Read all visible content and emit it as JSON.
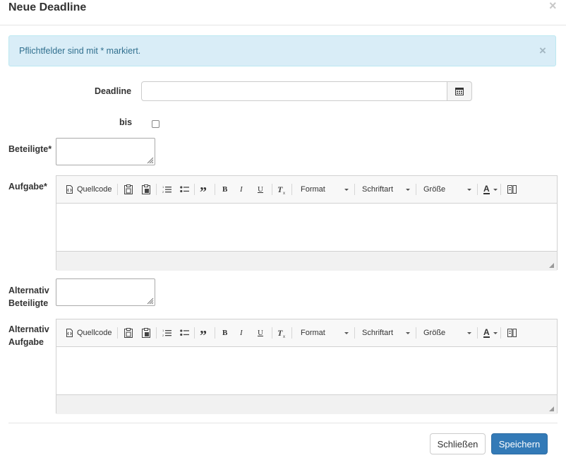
{
  "dialog": {
    "title": "Neue Deadline",
    "close_glyph": "×"
  },
  "alert": {
    "text": "Pflichtfelder sind mit * markiert.",
    "close_glyph": "×"
  },
  "form": {
    "deadline_label": "Deadline",
    "deadline_value": "",
    "bis_label": "bis",
    "bis_checked": false,
    "beteiligte_label": "Beteiligte*",
    "aufgabe_label": "Aufgabe*",
    "alt_beteiligte_label_1": "Alternativ",
    "alt_beteiligte_label_2": "Beteiligte",
    "alt_aufgabe_label_1": "Alternativ",
    "alt_aufgabe_label_2": "Aufgabe"
  },
  "toolbar": {
    "source_label": "Quellcode",
    "bold_label": "B",
    "italic_label": "I",
    "underline_label": "U",
    "quote_glyph": "”",
    "format_label": "Format",
    "font_label": "Schriftart",
    "size_label": "Größe",
    "color_label": "A",
    "icons": [
      "source-icon",
      "paste-icon",
      "paste-word-icon",
      "numbered-list-icon",
      "bullet-list-icon",
      "blockquote-icon",
      "remove-format-icon",
      "text-color-icon",
      "maximize-icon"
    ]
  },
  "buttons": {
    "close_label": "Schließen",
    "save_label": "Speichern"
  },
  "colors": {
    "alert_bg": "#d9edf7",
    "alert_text": "#31708f",
    "primary": "#337ab7"
  }
}
